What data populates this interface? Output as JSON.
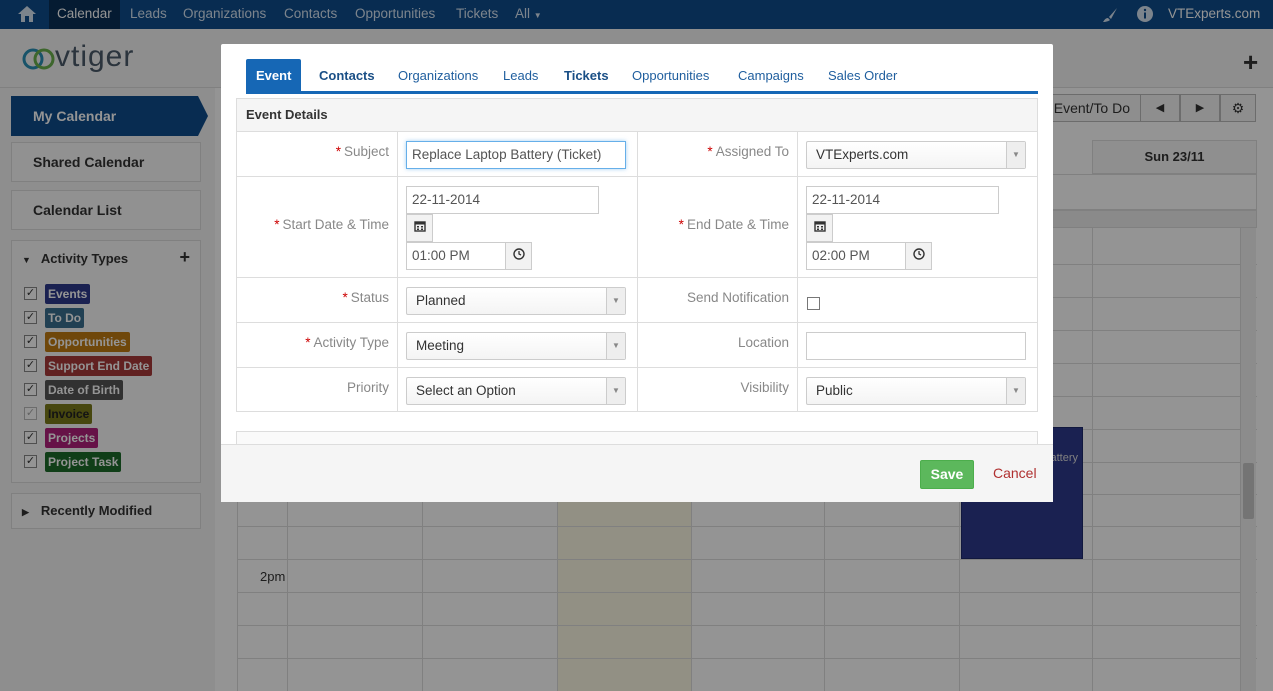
{
  "topnav": {
    "items": [
      "Calendar",
      "Leads",
      "Organizations",
      "Contacts",
      "Opportunities",
      "Tickets",
      "All"
    ],
    "user": "VTExperts.com"
  },
  "header": {
    "logo_text": "vtiger"
  },
  "sidebar": {
    "my_calendar": "My Calendar",
    "shared_calendar": "Shared Calendar",
    "calendar_list": "Calendar List",
    "activity_types_title": "Activity Types",
    "activity_types": [
      {
        "label": "Events",
        "color": "#2e3a8c"
      },
      {
        "label": "To Do",
        "color": "#3a6e8f"
      },
      {
        "label": "Opportunities",
        "color": "#c07a12"
      },
      {
        "label": "Support End Date",
        "color": "#a83a3a"
      },
      {
        "label": "Date of Birth",
        "color": "#555555"
      },
      {
        "label": "Invoice",
        "color": "#7a7a1a"
      },
      {
        "label": "Projects",
        "color": "#b0207a"
      },
      {
        "label": "Project Task",
        "color": "#1d6b2a"
      }
    ],
    "recently_modified": "Recently Modified"
  },
  "calendar": {
    "add_button": "Add Event/To Do",
    "day_header": "Sun 23/11",
    "time_label": "2pm",
    "event_text": "Battery"
  },
  "modal": {
    "tabs": [
      "Event",
      "Contacts",
      "Organizations",
      "Leads",
      "Tickets",
      "Opportunities",
      "Campaigns",
      "Sales Order"
    ],
    "section_title": "Event Details",
    "subject_label": "Subject",
    "subject_value": "Replace Laptop Battery (Ticket)",
    "assigned_label": "Assigned To",
    "assigned_value": "VTExperts.com",
    "start_label": "Start Date & Time",
    "start_date": "22-11-2014",
    "start_time": "01:00 PM",
    "end_label": "End Date & Time",
    "end_date": "22-11-2014",
    "end_time": "02:00 PM",
    "status_label": "Status",
    "status_value": "Planned",
    "notify_label": "Send Notification",
    "activity_label": "Activity Type",
    "activity_value": "Meeting",
    "location_label": "Location",
    "location_value": "",
    "priority_label": "Priority",
    "priority_value": "Select an Option",
    "visibility_label": "Visibility",
    "visibility_value": "Public",
    "save_label": "Save",
    "cancel_label": "Cancel"
  }
}
